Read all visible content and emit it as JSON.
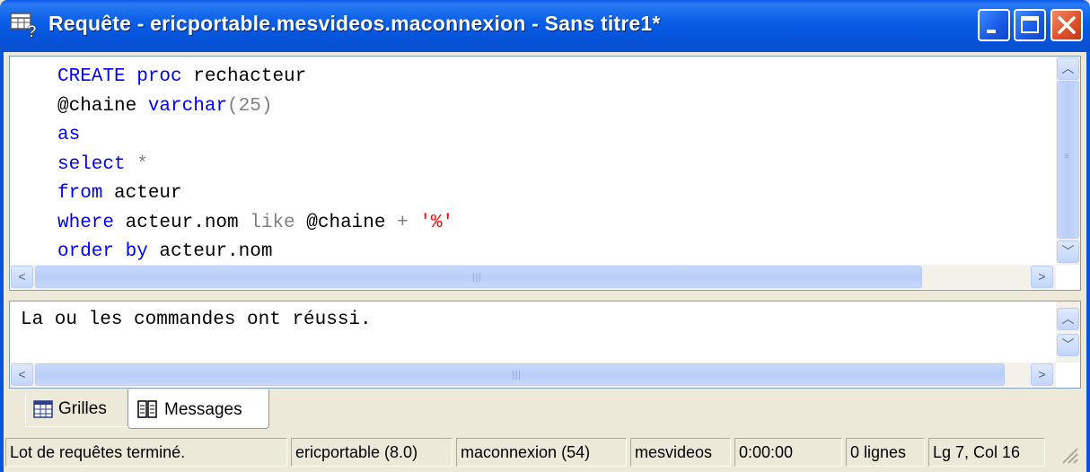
{
  "window": {
    "title": "Requête - ericportable.mesvideos.maconnexion - Sans titre1*",
    "icon": "query-window-icon",
    "controls": [
      "minimize-icon",
      "maximize-icon",
      "close-icon"
    ]
  },
  "editor": {
    "lines": [
      [
        {
          "t": "CREATE proc",
          "c": "kw"
        },
        {
          "t": " rechacteur",
          "c": "plain"
        }
      ],
      [
        {
          "t": "@chaine ",
          "c": "plain"
        },
        {
          "t": "varchar",
          "c": "kw"
        },
        {
          "t": "(25)",
          "c": "op"
        }
      ],
      [
        {
          "t": "as",
          "c": "kw"
        }
      ],
      [
        {
          "t": "select",
          "c": "kw"
        },
        {
          "t": " *",
          "c": "op"
        }
      ],
      [
        {
          "t": "from",
          "c": "kw"
        },
        {
          "t": " acteur",
          "c": "plain"
        }
      ],
      [
        {
          "t": "where",
          "c": "kw"
        },
        {
          "t": " acteur.nom ",
          "c": "plain"
        },
        {
          "t": "like",
          "c": "op"
        },
        {
          "t": " @chaine ",
          "c": "plain"
        },
        {
          "t": "+ ",
          "c": "op"
        },
        {
          "t": "'%'",
          "c": "str"
        }
      ],
      [
        {
          "t": "order by",
          "c": "kw"
        },
        {
          "t": " acteur.nom",
          "c": "plain"
        }
      ]
    ],
    "colors": {
      "kw": "#0000ff",
      "op": "#808080",
      "str": "#ff0000",
      "plain": "#000000"
    }
  },
  "messages": {
    "text": "La ou les commandes ont réussi."
  },
  "tabs": [
    {
      "label": "Grilles",
      "icon": "grid-icon",
      "active": false
    },
    {
      "label": "Messages",
      "icon": "messages-icon",
      "active": true
    }
  ],
  "status": {
    "batch": "Lot de requêtes terminé.",
    "server": "ericportable (8.0)",
    "connection": "maconnexion (54)",
    "database": "mesvideos",
    "elapsed": "0:00:00",
    "rows": "0 lignes",
    "position": "Lg 7, Col 16"
  },
  "accent_colors": {
    "titlebar": "#0a5fe6",
    "close": "#e0512b",
    "frame": "#ece9d8"
  }
}
